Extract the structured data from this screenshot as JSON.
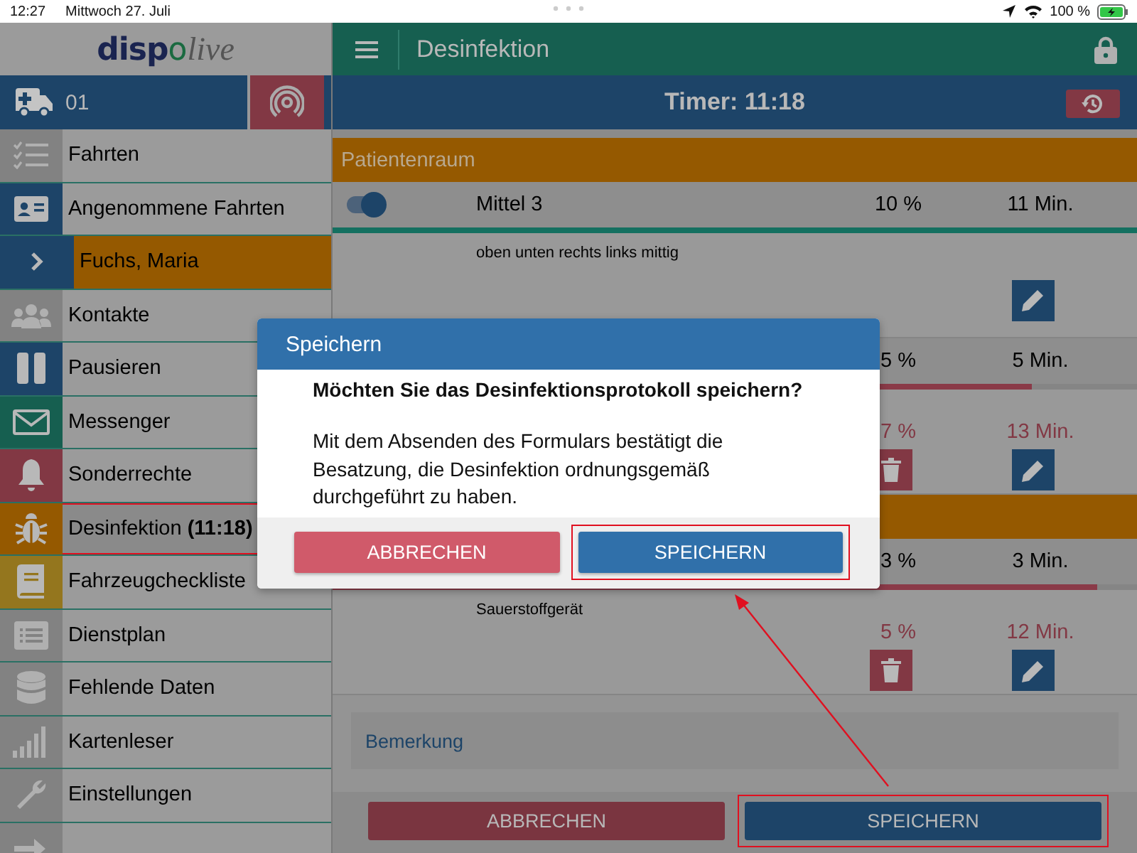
{
  "status_bar": {
    "time": "12:27",
    "date": "Mittwoch 27. Juli",
    "battery": "100 %"
  },
  "sidebar": {
    "logo": {
      "brand": "disp",
      "mark": "o",
      "suffix": "live"
    },
    "vehicle": "01",
    "radio": {
      "connected": false
    },
    "items": [
      {
        "kind": "item",
        "label": "Fahrten",
        "color": "#828282",
        "selected": false,
        "annotated": false
      },
      {
        "kind": "item",
        "label": "Angenommene Fahrten",
        "color": "#1d4468",
        "selected": false,
        "annotated": false
      },
      {
        "kind": "patient",
        "label": "Fuchs, Maria",
        "color": "#955900",
        "selected": false,
        "annotated": false
      },
      {
        "kind": "item",
        "label": "Kontakte",
        "color": "#828282",
        "selected": false,
        "annotated": false
      },
      {
        "kind": "item",
        "label": "Pausieren",
        "color": "#1d4468",
        "selected": false,
        "annotated": false
      },
      {
        "kind": "item",
        "label": "Messenger",
        "color": "#165f50",
        "selected": false,
        "annotated": false
      },
      {
        "kind": "item",
        "label": "Sonderrechte",
        "color": "#823844",
        "selected": false,
        "annotated": false
      },
      {
        "kind": "item",
        "label": "Desinfektion **(11:18)**",
        "color": "#955900",
        "selected": true,
        "annotated": true
      },
      {
        "kind": "item",
        "label": "Fahrzeugcheckliste",
        "color": "#94761e",
        "selected": false,
        "annotated": false
      },
      {
        "kind": "item",
        "label": "Dienstplan",
        "color": "#828282",
        "selected": false,
        "annotated": false
      },
      {
        "kind": "item",
        "label": "Fehlende Daten",
        "color": "#828282",
        "selected": false,
        "annotated": false
      },
      {
        "kind": "item",
        "label": "Kartenleser",
        "color": "#828282",
        "selected": false,
        "annotated": false
      },
      {
        "kind": "item",
        "label": "Einstellungen",
        "color": "#828282",
        "selected": false,
        "annotated": false
      },
      {
        "kind": "item",
        "color": "#828282",
        "selected": false,
        "annotated": false
      }
    ]
  },
  "header": {
    "title": "Desinfektion"
  },
  "timer": "Timer: 11:18",
  "sections": [
    {
      "title": "Patientenraum",
      "items": [
        {
          "name": "Mittel 3",
          "toggle_on": true,
          "percent": "10 %",
          "time": "11 Min.",
          "level": 1,
          "overdue": false,
          "entries": [
            {
              "text": "oben unten rechts links mittig",
              "deletable": false
            }
          ]
        },
        {
          "percent": "5 %",
          "time": "5 Min.",
          "level": 0.87,
          "overdue": true,
          "entries": [
            {
              "percent": "7 %",
              "time": "13 Min.",
              "deletable": true
            }
          ]
        }
      ]
    },
    {
      "items": [
        {
          "percent": "3 %",
          "time": "3 Min.",
          "level": 0.95,
          "overdue": true,
          "entries": [
            {
              "text": "Sauerstoffgerät",
              "percent": "5 %",
              "time": "12 Min.",
              "deletable": true
            }
          ]
        }
      ]
    }
  ],
  "remark": {
    "placeholder": "Bemerkung"
  },
  "buttons": [
    {
      "kind": "cancel",
      "label": "ABBRECHEN",
      "annotated": false
    },
    {
      "kind": "save",
      "label": "SPEICHERN",
      "annotated": true
    }
  ],
  "dialog": {
    "title": "Speichern",
    "question": "Möchten Sie das Desinfektionsprotokoll speichern?",
    "message": "Mit dem Absenden des Formulars bestätigt die Besatzung, die Desinfektion ordnungsgemäß durchgeführt zu haben.",
    "buttons": [
      {
        "kind": "cancel",
        "label": "ABBRECHEN",
        "annotated": false
      },
      {
        "kind": "save",
        "label": "SPEICHERN",
        "annotated": true
      }
    ]
  }
}
